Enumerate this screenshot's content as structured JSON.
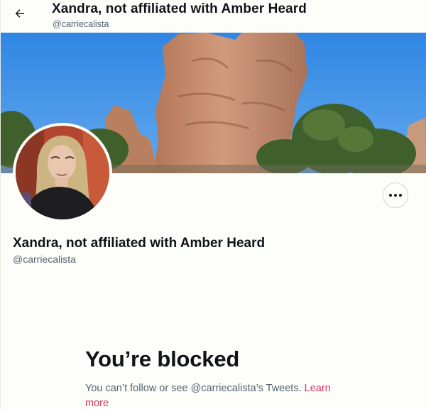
{
  "header": {
    "title": "Xandra, not affiliated with Amber Heard",
    "handle": "@carriecalista"
  },
  "profile": {
    "name": "Xandra, not affiliated with Amber Heard",
    "handle": "@carriecalista"
  },
  "blocked": {
    "title": "You’re blocked",
    "message": "You can’t follow or see @carriecalista’s Tweets.",
    "link_label": "Learn more"
  },
  "icons": {
    "back": "arrow-left-icon",
    "more": "more-horizontal-icon"
  },
  "colors": {
    "background": "#fdfdfa",
    "primary_text": "#0f1419",
    "secondary_text": "#536471",
    "link": "#d9365f",
    "sky": "#3f8fe0",
    "rock": "#c98f70"
  }
}
